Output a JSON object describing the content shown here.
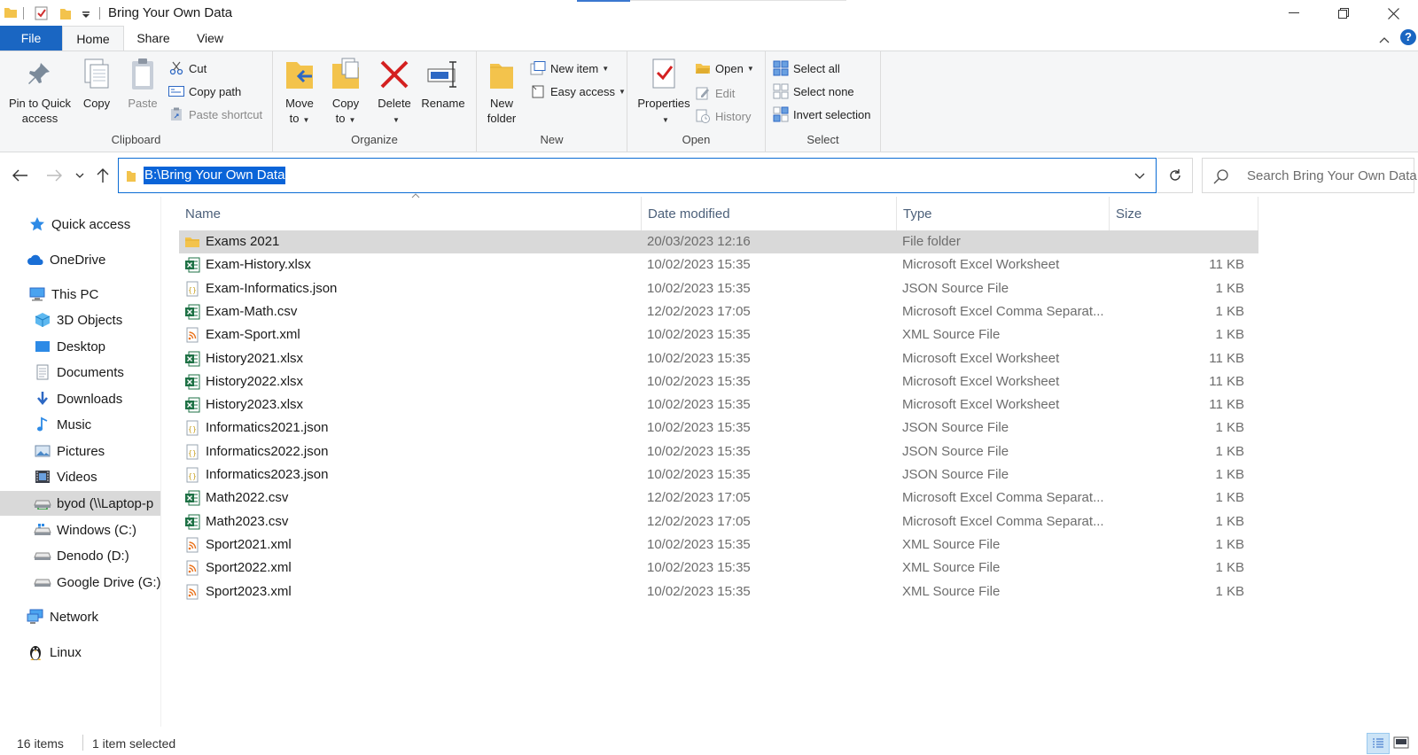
{
  "window": {
    "title": "Bring Your Own Data",
    "minimize_icon": "minimize-icon",
    "restore_icon": "restore-icon",
    "close_icon": "close-icon"
  },
  "ribbon_tabs": {
    "file": "File",
    "home": "Home",
    "share": "Share",
    "view": "View"
  },
  "clipboard": {
    "pin_label_1": "Pin to Quick",
    "pin_label_2": "access",
    "copy": "Copy",
    "paste": "Paste",
    "cut": "Cut",
    "copy_path": "Copy path",
    "paste_shortcut": "Paste shortcut",
    "group": "Clipboard"
  },
  "organize": {
    "move_1": "Move",
    "move_2": "to",
    "copy_1": "Copy",
    "copy_2": "to",
    "delete": "Delete",
    "rename": "Rename",
    "group": "Organize"
  },
  "new_group": {
    "new_folder_1": "New",
    "new_folder_2": "folder",
    "new_item": "New item",
    "easy_access": "Easy access",
    "group": "New"
  },
  "open_group": {
    "properties": "Properties",
    "open": "Open",
    "edit": "Edit",
    "history": "History",
    "group": "Open"
  },
  "select_group": {
    "select_all": "Select all",
    "select_none": "Select none",
    "invert": "Invert selection",
    "group": "Select"
  },
  "address": {
    "path": "B:\\Bring Your Own Data"
  },
  "search": {
    "placeholder": "Search Bring Your Own Data"
  },
  "nav": {
    "items": [
      {
        "label": "Quick access"
      },
      {
        "label": "OneDrive"
      },
      {
        "label": "This PC"
      },
      {
        "label": "3D Objects"
      },
      {
        "label": "Desktop"
      },
      {
        "label": "Documents"
      },
      {
        "label": "Downloads"
      },
      {
        "label": "Music"
      },
      {
        "label": "Pictures"
      },
      {
        "label": "Videos"
      },
      {
        "label": "byod (\\\\Laptop-p"
      },
      {
        "label": "Windows (C:)"
      },
      {
        "label": "Denodo (D:)"
      },
      {
        "label": "Google Drive (G:)"
      },
      {
        "label": "Network"
      },
      {
        "label": "Linux"
      }
    ]
  },
  "columns": {
    "name": "Name",
    "date": "Date modified",
    "type": "Type",
    "size": "Size"
  },
  "files": [
    {
      "name": "Exams 2021",
      "date": "20/03/2023 12:16",
      "type": "File folder",
      "size": "",
      "icon": "folder-icon"
    },
    {
      "name": "Exam-History.xlsx",
      "date": "10/02/2023 15:35",
      "type": "Microsoft Excel Worksheet",
      "size": "11 KB",
      "icon": "excel-icon"
    },
    {
      "name": "Exam-Informatics.json",
      "date": "10/02/2023 15:35",
      "type": "JSON Source File",
      "size": "1 KB",
      "icon": "json-icon"
    },
    {
      "name": "Exam-Math.csv",
      "date": "12/02/2023 17:05",
      "type": "Microsoft Excel Comma Separat...",
      "size": "1 KB",
      "icon": "excel-icon"
    },
    {
      "name": "Exam-Sport.xml",
      "date": "10/02/2023 15:35",
      "type": "XML Source File",
      "size": "1 KB",
      "icon": "xml-icon"
    },
    {
      "name": "History2021.xlsx",
      "date": "10/02/2023 15:35",
      "type": "Microsoft Excel Worksheet",
      "size": "11 KB",
      "icon": "excel-icon"
    },
    {
      "name": "History2022.xlsx",
      "date": "10/02/2023 15:35",
      "type": "Microsoft Excel Worksheet",
      "size": "11 KB",
      "icon": "excel-icon"
    },
    {
      "name": "History2023.xlsx",
      "date": "10/02/2023 15:35",
      "type": "Microsoft Excel Worksheet",
      "size": "11 KB",
      "icon": "excel-icon"
    },
    {
      "name": "Informatics2021.json",
      "date": "10/02/2023 15:35",
      "type": "JSON Source File",
      "size": "1 KB",
      "icon": "json-icon"
    },
    {
      "name": "Informatics2022.json",
      "date": "10/02/2023 15:35",
      "type": "JSON Source File",
      "size": "1 KB",
      "icon": "json-icon"
    },
    {
      "name": "Informatics2023.json",
      "date": "10/02/2023 15:35",
      "type": "JSON Source File",
      "size": "1 KB",
      "icon": "json-icon"
    },
    {
      "name": "Math2022.csv",
      "date": "12/02/2023 17:05",
      "type": "Microsoft Excel Comma Separat...",
      "size": "1 KB",
      "icon": "excel-icon"
    },
    {
      "name": "Math2023.csv",
      "date": "12/02/2023 17:05",
      "type": "Microsoft Excel Comma Separat...",
      "size": "1 KB",
      "icon": "excel-icon"
    },
    {
      "name": "Sport2021.xml",
      "date": "10/02/2023 15:35",
      "type": "XML Source File",
      "size": "1 KB",
      "icon": "xml-icon"
    },
    {
      "name": "Sport2022.xml",
      "date": "10/02/2023 15:35",
      "type": "XML Source File",
      "size": "1 KB",
      "icon": "xml-icon"
    },
    {
      "name": "Sport2023.xml",
      "date": "10/02/2023 15:35",
      "type": "XML Source File",
      "size": "1 KB",
      "icon": "xml-icon"
    }
  ],
  "status": {
    "count": "16 items",
    "selected": "1 item selected"
  },
  "colors": {
    "accent": "#1a66c2",
    "selection": "#0a64d8",
    "row_selected": "#d9d9d9"
  }
}
